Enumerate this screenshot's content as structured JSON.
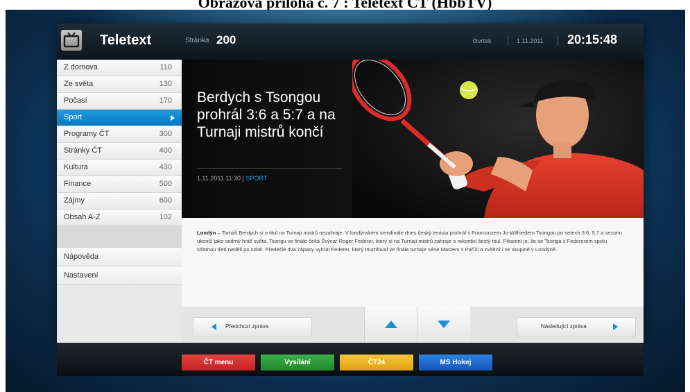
{
  "caption": "Obrazová příloha č. 7 : Teletext ČT (HbbTV)",
  "header": {
    "app_title": "Teletext",
    "page_label": "Stránka",
    "page_number": "200",
    "day": "čtvrtek",
    "date": "1.11.2011",
    "time": "20:15:48"
  },
  "sidebar": {
    "items": [
      {
        "label": "Z domova",
        "page": "110"
      },
      {
        "label": "Ze světa",
        "page": "130"
      },
      {
        "label": "Počasí",
        "page": "170"
      },
      {
        "label": "Sport",
        "page": ""
      },
      {
        "label": "Programy ČT",
        "page": "300"
      },
      {
        "label": "Stránky ČT",
        "page": "400"
      },
      {
        "label": "Kultura",
        "page": "430"
      },
      {
        "label": "Finance",
        "page": "500"
      },
      {
        "label": "Zájmy",
        "page": "600"
      },
      {
        "label": "Obsah A-Z",
        "page": "102"
      }
    ],
    "active_index": 3,
    "help_label": "Nápověda",
    "settings_label": "Nastavení"
  },
  "article": {
    "headline": "Berdych s Tsongou prohrál 3:6 a 5:7 a na Turnaji mistrů končí",
    "timestamp": "1.11.2011 11:30",
    "separator": "|",
    "category": "SPORT",
    "lead": "Londýn",
    "body": " – Tomáš Berdych si o titul na Turnaji mistrů nezahraje. V londýnském semifinále dnes český tenista prohrál s Francouzem Jo-Wilfriedem Tsongou po setech 3:6, 5:7 a sezonu ukončí jako sedmý hráč světa. Tsongu ve finále čeká Švýcar Roger Federer, který si na Turnaji mistrů zahraje o rekordní šestý titul. Pikantní je, že se Tsonga s Federerem spolu střetnou třetí neděli po sobě. Předešlé dva zápasy vyhrál Federer, který triumfoval ve finále turnaje série Masters v Paříži a zvítězil i ve skupině v Londýně."
  },
  "navigation": {
    "prev_label": "Předchozí zpráva",
    "next_label": "Následující zpráva"
  },
  "color_buttons": [
    {
      "label": "ČT menu",
      "color": "#d9262b"
    },
    {
      "label": "Vysílání",
      "color": "#2f9b3a"
    },
    {
      "label": "ČT24",
      "color": "#f0b421"
    },
    {
      "label": "MS Hokej",
      "color": "#1f6fd1"
    }
  ],
  "colors": {
    "accent": "#0a86cf",
    "header_bg": "#16222c"
  }
}
